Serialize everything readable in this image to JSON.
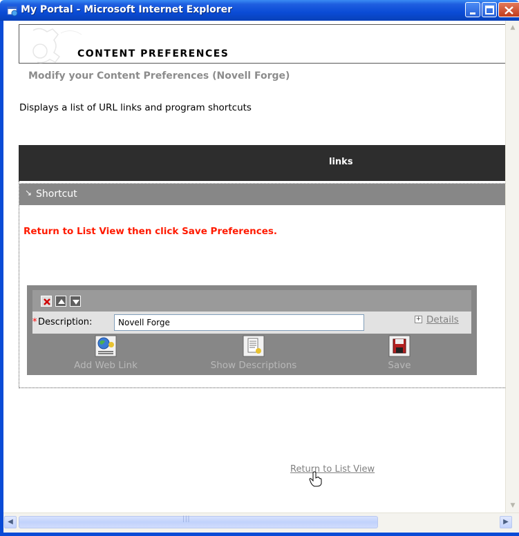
{
  "window": {
    "title": "My Portal - Microsoft Internet Explorer"
  },
  "header": {
    "title": "CONTENT PREFERENCES",
    "subtitle": "Modify your Content Preferences (Novell Forge)"
  },
  "description": "Displays a list of URL links and program shortcuts",
  "links_bar": {
    "label": "links"
  },
  "shortcut": {
    "label": "Shortcut"
  },
  "warning": "Return to List View then click Save Preferences.",
  "editor": {
    "description_label": "Description:",
    "description_value": "Novell Forge",
    "details_label": "Details",
    "actions": {
      "add_web_link": "Add Web Link",
      "show_descriptions": "Show Descriptions",
      "save": "Save"
    }
  },
  "footer": {
    "return_link": "Return to List View"
  },
  "colors": {
    "titlebar": "#0a4bd6",
    "links_bar": "#2d2d2d",
    "shortcut_bar": "#878787",
    "warning": "#ff1a00",
    "muted_text": "#8c8c8c"
  }
}
